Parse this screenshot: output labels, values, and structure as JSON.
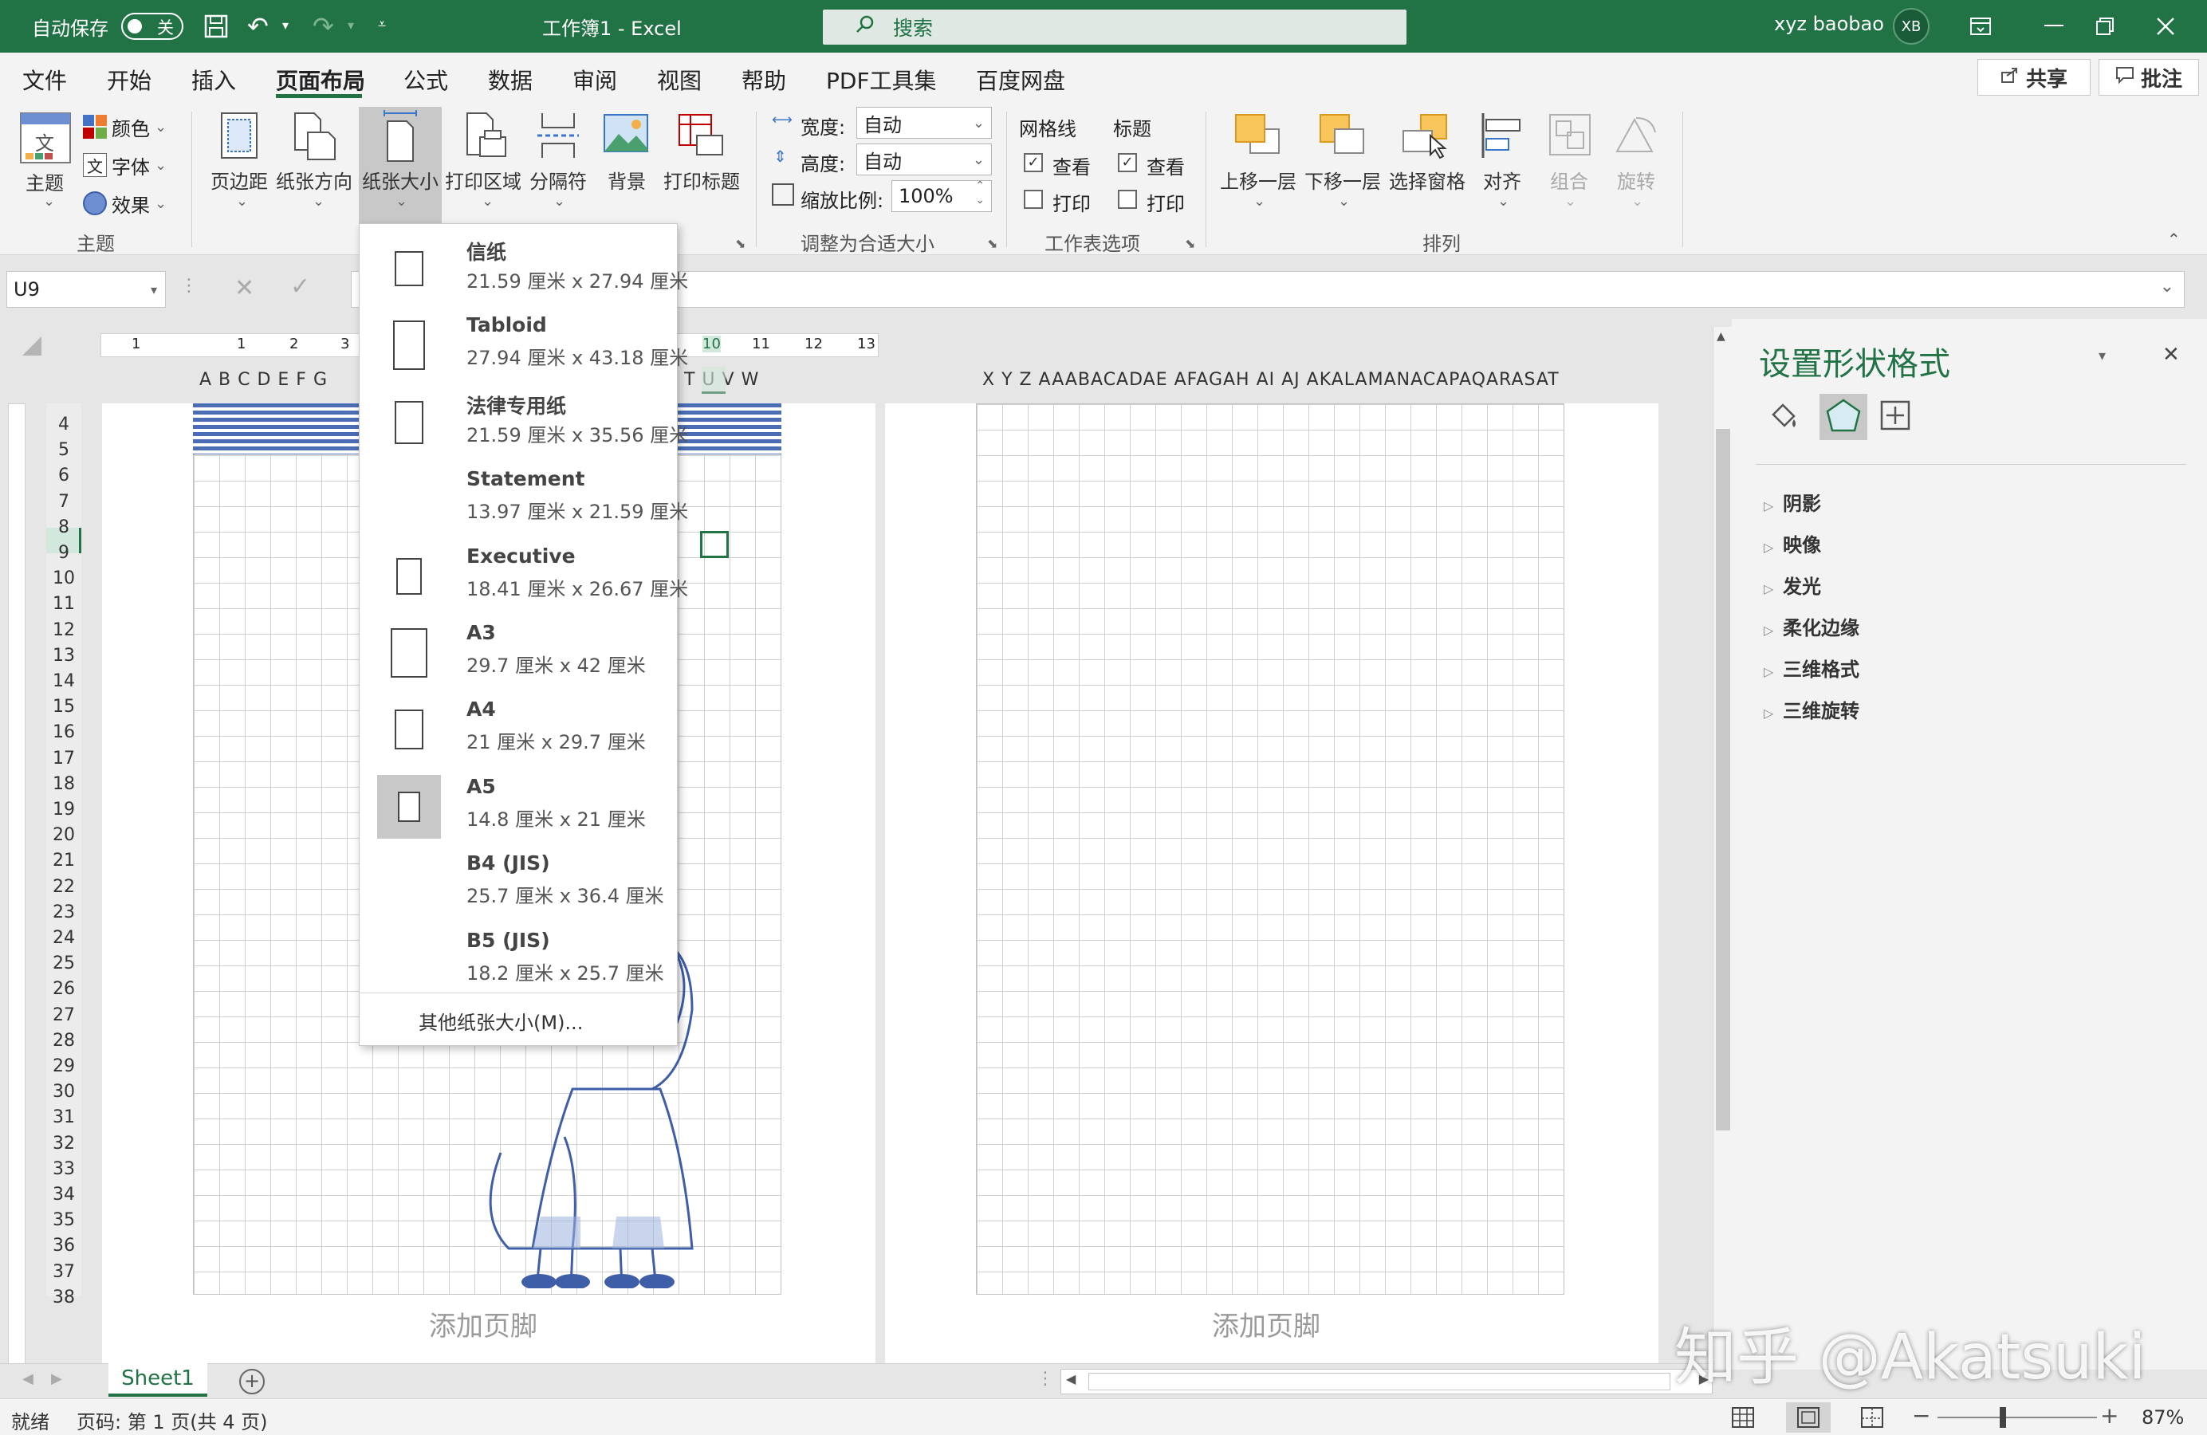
{
  "titlebar": {
    "autosave_label": "自动保存",
    "autosave_state": "关",
    "doc_title": "工作簿1  -  Excel",
    "search_placeholder": "搜索",
    "user_name": "xyz baobao",
    "user_initials": "XB"
  },
  "menu": {
    "items": [
      "文件",
      "开始",
      "插入",
      "页面布局",
      "公式",
      "数据",
      "审阅",
      "视图",
      "帮助",
      "PDF工具集",
      "百度网盘"
    ],
    "active": "页面布局",
    "share_label": "共享",
    "comment_label": "批注"
  },
  "ribbon": {
    "theme": {
      "main_label": "主题",
      "colors": "颜色",
      "fonts": "字体",
      "effects": "效果",
      "group": "主题"
    },
    "page_setup": {
      "margins": "页边距",
      "orientation": "纸张方向",
      "size": "纸张大小",
      "print_area": "打印区域",
      "breaks": "分隔符",
      "background": "背景",
      "print_titles": "打印标题"
    },
    "scale": {
      "width_label": "宽度:",
      "width_value": "自动",
      "height_label": "高度:",
      "height_value": "自动",
      "scale_label": "缩放比例:",
      "scale_value": "100%",
      "group": "调整为合适大小"
    },
    "sheet_options": {
      "gridlines": "网格线",
      "headings": "标题",
      "view": "查看",
      "print": "打印",
      "group": "工作表选项"
    },
    "arrange": {
      "bring_forward": "上移一层",
      "send_backward": "下移一层",
      "selection_pane": "选择窗格",
      "align": "对齐",
      "group_btn": "组合",
      "rotate": "旋转",
      "group": "排列"
    }
  },
  "formula_bar": {
    "name_box": "U9"
  },
  "paper_sizes": {
    "items": [
      {
        "name": "信纸",
        "dims": "21.59 厘米 x 27.94 厘米",
        "icon": "portrait"
      },
      {
        "name": "Tabloid",
        "dims": "27.94 厘米 x 43.18 厘米",
        "icon": "portrait"
      },
      {
        "name": "法律专用纸",
        "dims": "21.59 厘米 x 35.56 厘米",
        "icon": "portrait"
      },
      {
        "name": "Statement",
        "dims": "13.97 厘米 x 21.59 厘米",
        "icon": "none"
      },
      {
        "name": "Executive",
        "dims": "18.41 厘米 x 26.67 厘米",
        "icon": "portrait"
      },
      {
        "name": "A3",
        "dims": "29.7 厘米 x 42 厘米",
        "icon": "portrait"
      },
      {
        "name": "A4",
        "dims": "21 厘米 x 29.7 厘米",
        "icon": "portrait"
      },
      {
        "name": "A5",
        "dims": "14.8 厘米 x 21 厘米",
        "icon": "portrait"
      },
      {
        "name": "B4 (JIS)",
        "dims": "25.7 厘米 x 36.4 厘米",
        "icon": "none"
      },
      {
        "name": "B5 (JIS)",
        "dims": "18.2 厘米 x 25.7 厘米",
        "icon": "none"
      }
    ],
    "selected": "A5",
    "more_label": "其他纸张大小(M)..."
  },
  "worksheet": {
    "ruler_numbers": [
      "1",
      "1",
      "2",
      "3",
      "10",
      "11",
      "12",
      "13"
    ],
    "left_columns": "A B C D E F G",
    "mid_columns": "T U V W",
    "right_columns": "X  Y  Z  AAABACADAE AFAGAH AI  AJ AKALAMANACAPAQARASAT",
    "rows": [
      "4",
      "5",
      "6",
      "7",
      "8",
      "9",
      "10",
      "11",
      "12",
      "13",
      "14",
      "15",
      "16",
      "17",
      "18",
      "19",
      "20",
      "21",
      "22",
      "23",
      "24",
      "25",
      "26",
      "27",
      "28",
      "29",
      "30",
      "31",
      "32",
      "33",
      "34",
      "35",
      "36",
      "37",
      "38"
    ],
    "footer_left": "添加页脚",
    "footer_right": "添加页脚"
  },
  "format_pane": {
    "title": "设置形状格式",
    "sections": [
      "阴影",
      "映像",
      "发光",
      "柔化边缘",
      "三维格式",
      "三维旋转"
    ]
  },
  "sheet_tabs": {
    "tab": "Sheet1"
  },
  "status": {
    "ready": "就绪",
    "page_info": "页码: 第 1 页(共 4 页)",
    "zoom": "87%"
  },
  "watermark": "知乎 @Akatsuki",
  "colors": {
    "excel_green": "#217346",
    "band_blue": "#4a6db5"
  }
}
